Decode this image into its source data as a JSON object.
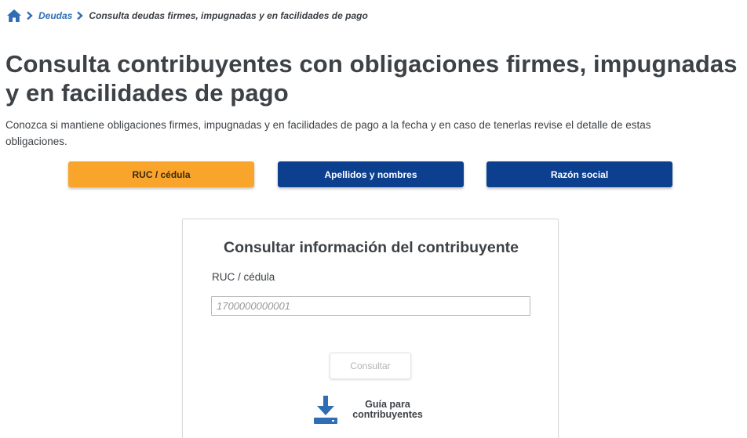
{
  "breadcrumb": {
    "home_icon": "home-icon",
    "items": [
      "Deudas"
    ],
    "current": "Consulta deudas firmes, impugnadas y en facilidades de pago"
  },
  "page": {
    "title": "Consulta contribuyentes con obligaciones firmes, impugnadas y en facilidades de pago",
    "description": "Conozca si mantiene obligaciones firmes, impugnadas y en facilidades de pago a la fecha y en caso de tenerlas revise el detalle de estas obligaciones."
  },
  "tabs": [
    {
      "label": "RUC / cédula",
      "active": true
    },
    {
      "label": "Apellidos y nombres",
      "active": false
    },
    {
      "label": "Razón social",
      "active": false
    }
  ],
  "form": {
    "title": "Consultar información del contribuyente",
    "field_label": "RUC / cédula",
    "input_value": "",
    "input_placeholder": "1700000000001",
    "submit_label": "Consultar",
    "guide_line1": "Guía para",
    "guide_line2": "contribuyentes",
    "guide_icon": "download-icon"
  },
  "colors": {
    "accent_orange": "#f9a52c",
    "primary_blue": "#0d3f8f",
    "link_blue": "#2f6eb5"
  }
}
